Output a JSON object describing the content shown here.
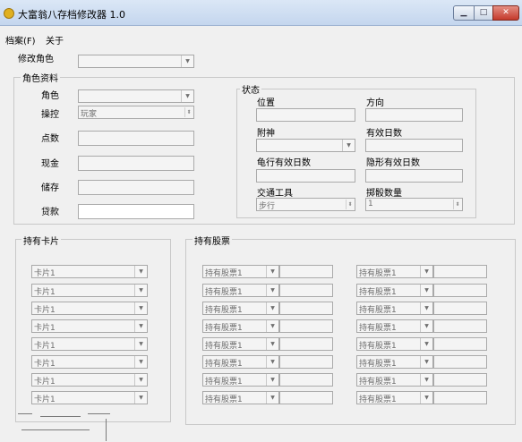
{
  "window": {
    "title": "大富翁八存档修改器 1.0"
  },
  "menu": [
    "档案(F)",
    "关于"
  ],
  "modify_role": {
    "label": "修改角色",
    "value": ""
  },
  "role_info": {
    "title": "角色资料",
    "role_label": "角色",
    "role_value": "",
    "control_label": "操控",
    "control_value": "玩家",
    "points_label": "点数",
    "cash_label": "现金",
    "savings_label": "储存",
    "loan_label": "贷款"
  },
  "status": {
    "title": "状态",
    "position_label": "位置",
    "direction_label": "方向",
    "spirit_label": "附神",
    "spirit_value": "",
    "spirit_days_label": "有效日数",
    "turtle_days_label": "龟行有效日数",
    "invisible_days_label": "隐形有效日数",
    "vehicle_label": "交通工具",
    "vehicle_value": "步行",
    "bomb_count_label": "掷骰数量",
    "bomb_count_value": "1"
  },
  "cards": {
    "title": "持有卡片",
    "items": [
      "卡片1",
      "卡片1",
      "卡片1",
      "卡片1",
      "卡片1",
      "卡片1",
      "卡片1",
      "卡片1"
    ]
  },
  "stocks": {
    "title": "持有股票",
    "items": [
      "持有股票1",
      "持有股票1",
      "持有股票1",
      "持有股票1",
      "持有股票1",
      "持有股票1",
      "持有股票1",
      "持有股票1",
      "持有股票1",
      "持有股票1",
      "持有股票1",
      "持有股票1",
      "持有股票1",
      "持有股票1",
      "持有股票1",
      "持有股票1"
    ]
  },
  "icons": {
    "app": "money-bag-icon",
    "minimize": "minimize-icon",
    "maximize": "maximize-icon",
    "close": "close-icon",
    "dropdown": "chevron-down-icon",
    "spin": "spin-icon"
  },
  "colors": {
    "title_bar": "#c4d6ee",
    "window_bg": "#f0f0f0",
    "close_button": "#c4392b"
  }
}
